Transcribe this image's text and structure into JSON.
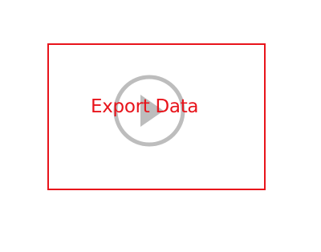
{
  "export_widget": {
    "label": "Export Data",
    "icon": "play-icon",
    "accent_color": "#e8141b",
    "icon_color": "#bdbdbd"
  }
}
